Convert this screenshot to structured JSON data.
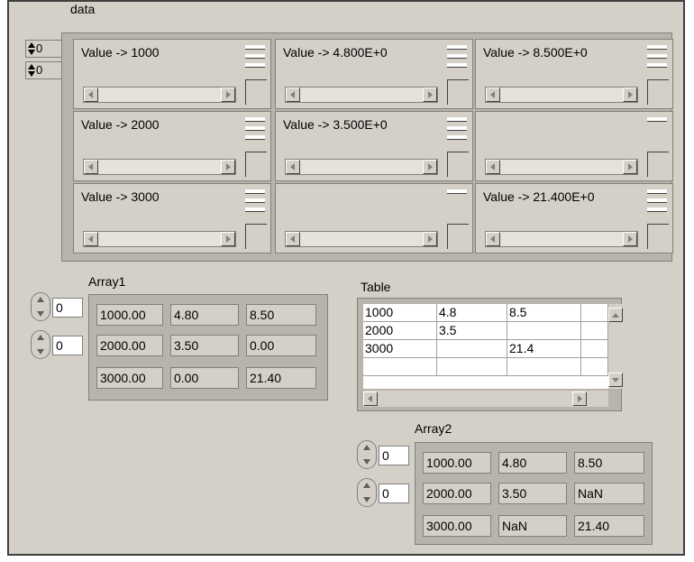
{
  "data_cluster": {
    "label": "data",
    "indices": [
      "0",
      "0"
    ],
    "cells": [
      "Value -> 1000",
      "Value -> 4.800E+0",
      "Value -> 8.500E+0",
      "Value -> 2000",
      "Value -> 3.500E+0",
      "",
      "Value -> 3000",
      "",
      "Value -> 21.400E+0"
    ]
  },
  "array1": {
    "label": "Array1",
    "indices": [
      "0",
      "0"
    ],
    "rows": [
      [
        "1000.00",
        "4.80",
        "8.50"
      ],
      [
        "2000.00",
        "3.50",
        "0.00"
      ],
      [
        "3000.00",
        "0.00",
        "21.40"
      ]
    ]
  },
  "table": {
    "label": "Table",
    "rows": [
      [
        "1000",
        "4.8",
        "8.5",
        ""
      ],
      [
        "2000",
        "3.5",
        "",
        ""
      ],
      [
        "3000",
        "",
        "21.4",
        ""
      ],
      [
        "",
        "",
        "",
        ""
      ]
    ]
  },
  "array2": {
    "label": "Array2",
    "indices": [
      "0",
      "0"
    ],
    "rows": [
      [
        "1000.00",
        "4.80",
        "8.50"
      ],
      [
        "2000.00",
        "3.50",
        "NaN"
      ],
      [
        "3000.00",
        "NaN",
        "21.40"
      ]
    ]
  }
}
